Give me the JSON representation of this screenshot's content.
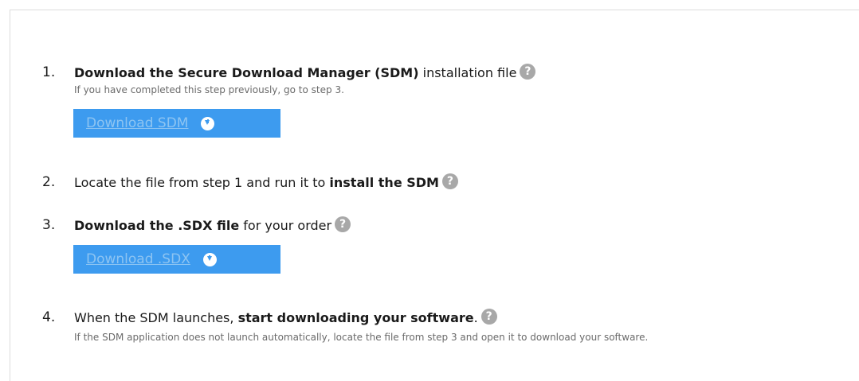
{
  "steps": [
    {
      "number": "1.",
      "parts": [
        {
          "text": "Download the Secure Download Manager (SDM)",
          "bold": true
        },
        {
          "text": " installation file",
          "bold": false
        }
      ],
      "sub": "If you have completed this step previously, go to step 3.",
      "button": "Download SDM"
    },
    {
      "number": "2.",
      "parts": [
        {
          "text": "Locate the file from step 1 and run it to ",
          "bold": false
        },
        {
          "text": "install the SDM",
          "bold": true
        }
      ]
    },
    {
      "number": "3.",
      "parts": [
        {
          "text": "Download the .SDX file",
          "bold": true
        },
        {
          "text": " for your order",
          "bold": false
        }
      ],
      "button": "Download .SDX"
    },
    {
      "number": "4.",
      "parts": [
        {
          "text": "When the SDM launches, ",
          "bold": false
        },
        {
          "text": "start downloading your software",
          "bold": true
        },
        {
          "text": ".",
          "bold": false
        }
      ],
      "sub": "If the SDM application does not launch automatically, locate the file from step 3 and open it to download your software."
    }
  ],
  "help_glyph": "?",
  "icons": {
    "help": "question-circle-icon",
    "download": "download-circle-icon"
  },
  "colors": {
    "button_bg": "#3d9bef",
    "button_text": "#8dc4f2",
    "help_bg": "#a8a8a8"
  }
}
